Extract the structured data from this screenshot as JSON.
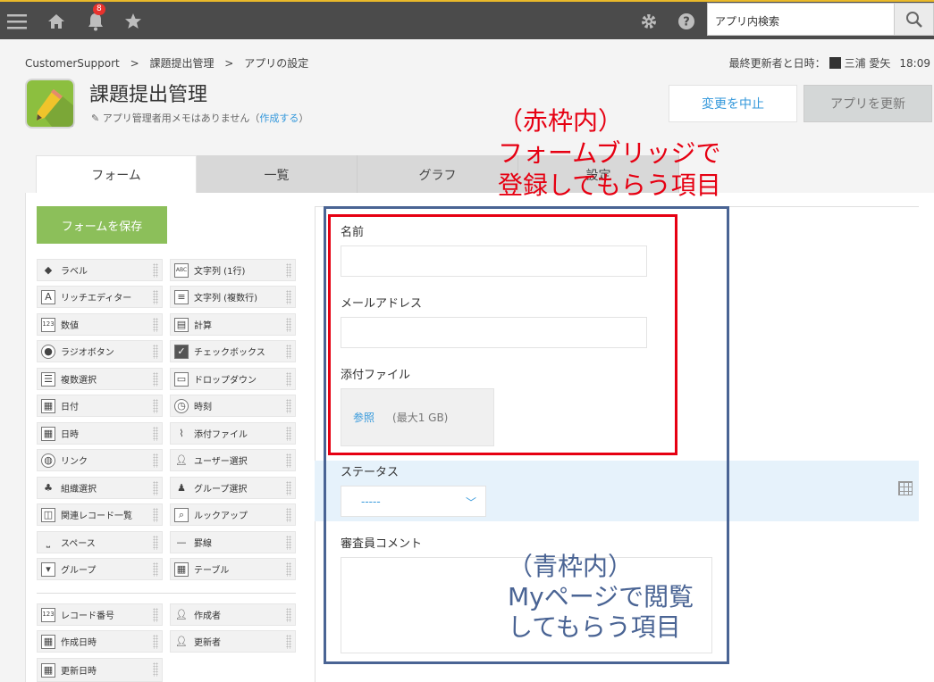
{
  "topbar": {
    "notification_count": "8",
    "search_placeholder": "アプリ内検索"
  },
  "breadcrumb": [
    "CustomerSupport",
    ">",
    "課題提出管理",
    ">",
    "アプリの設定"
  ],
  "updater": {
    "label": "最終更新者と日時：",
    "name": "三浦 愛矢",
    "time": "18:09"
  },
  "app": {
    "title": "課題提出管理",
    "memo_text": "アプリ管理者用メモはありません（",
    "memo_link": "作成する",
    "memo_close": "）"
  },
  "buttons": {
    "cancel": "変更を中止",
    "update": "アプリを更新",
    "save_form": "フォームを保存"
  },
  "tabs": [
    "フォーム",
    "一覧",
    "グラフ",
    "設定"
  ],
  "palette": {
    "left": [
      "ラベル",
      "リッチエディター",
      "数値",
      "ラジオボタン",
      "複数選択",
      "日付",
      "日時",
      "リンク",
      "組織選択",
      "関連レコード一覧",
      "スペース",
      "グループ"
    ],
    "right": [
      "文字列 (1行)",
      "文字列 (複数行)",
      "計算",
      "チェックボックス",
      "ドロップダウン",
      "時刻",
      "添付ファイル",
      "ユーザー選択",
      "グループ選択",
      "ルックアップ",
      "罫線",
      "テーブル"
    ],
    "system_left": [
      "レコード番号",
      "作成日時",
      "更新日時"
    ],
    "system_right": [
      "作成者",
      "更新者"
    ]
  },
  "form": {
    "name_label": "名前",
    "email_label": "メールアドレス",
    "file_label": "添付ファイル",
    "file_browse": "参照",
    "file_max": "(最大1 GB)",
    "status_label": "ステータス",
    "status_value": "-----",
    "comment_label": "審査員コメント"
  },
  "notes": {
    "red": "（赤枠内）\nフォームブリッジで\n登録してもらう項目",
    "blue": "（青枠内）\nMyページで閲覧\nしてもらう項目"
  }
}
